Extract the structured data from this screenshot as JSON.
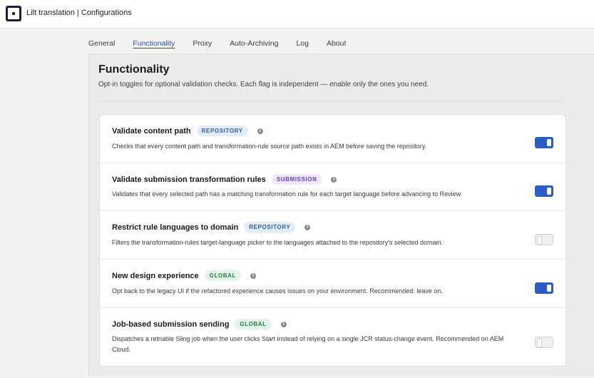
{
  "app": {
    "title": "Lilt translation | Configurations"
  },
  "tabs": [
    {
      "label": "General",
      "active": false
    },
    {
      "label": "Functionality",
      "active": true
    },
    {
      "label": "Proxy",
      "active": false
    },
    {
      "label": "Auto-Archiving",
      "active": false
    },
    {
      "label": "Log",
      "active": false
    },
    {
      "label": "About",
      "active": false
    }
  ],
  "section": {
    "title": "Functionality",
    "description": "Opt-in toggles for optional validation checks. Each flag is independent — enable only the ones you need."
  },
  "badge_colors": {
    "REPOSITORY": {
      "bg": "#e3edf9",
      "fg": "#2f5a9c"
    },
    "SUBMISSION": {
      "bg": "#efe6fa",
      "fg": "#6a3fa6"
    },
    "GLOBAL": {
      "bg": "#e4f3e8",
      "fg": "#2f7a47"
    }
  },
  "settings": [
    {
      "title": "Validate content path",
      "badge": "REPOSITORY",
      "description": "Checks that every content path and transformation-rule source path exists in AEM before saving the repository.",
      "enabled": true
    },
    {
      "title": "Validate submission transformation rules",
      "badge": "SUBMISSION",
      "description": "Validates that every selected path has a matching transformation rule for each target language before advancing to Review.",
      "enabled": true
    },
    {
      "title": "Restrict rule languages to domain",
      "badge": "REPOSITORY",
      "description": "Filters the transformation-rules target-language picker to the languages attached to the repository's selected domain.",
      "enabled": false
    },
    {
      "title": "New design experience",
      "badge": "GLOBAL",
      "description": "Opt back to the legacy UI if the refactored experience causes issues on your environment. Recommended: leave on.",
      "enabled": true
    },
    {
      "title": "Job-based submission sending",
      "badge": "GLOBAL",
      "description": "Dispatches a retriable Sling job when the user clicks Start instead of relying on a single JCR status-change event. Recommended on AEM Cloud.",
      "enabled": false
    }
  ]
}
